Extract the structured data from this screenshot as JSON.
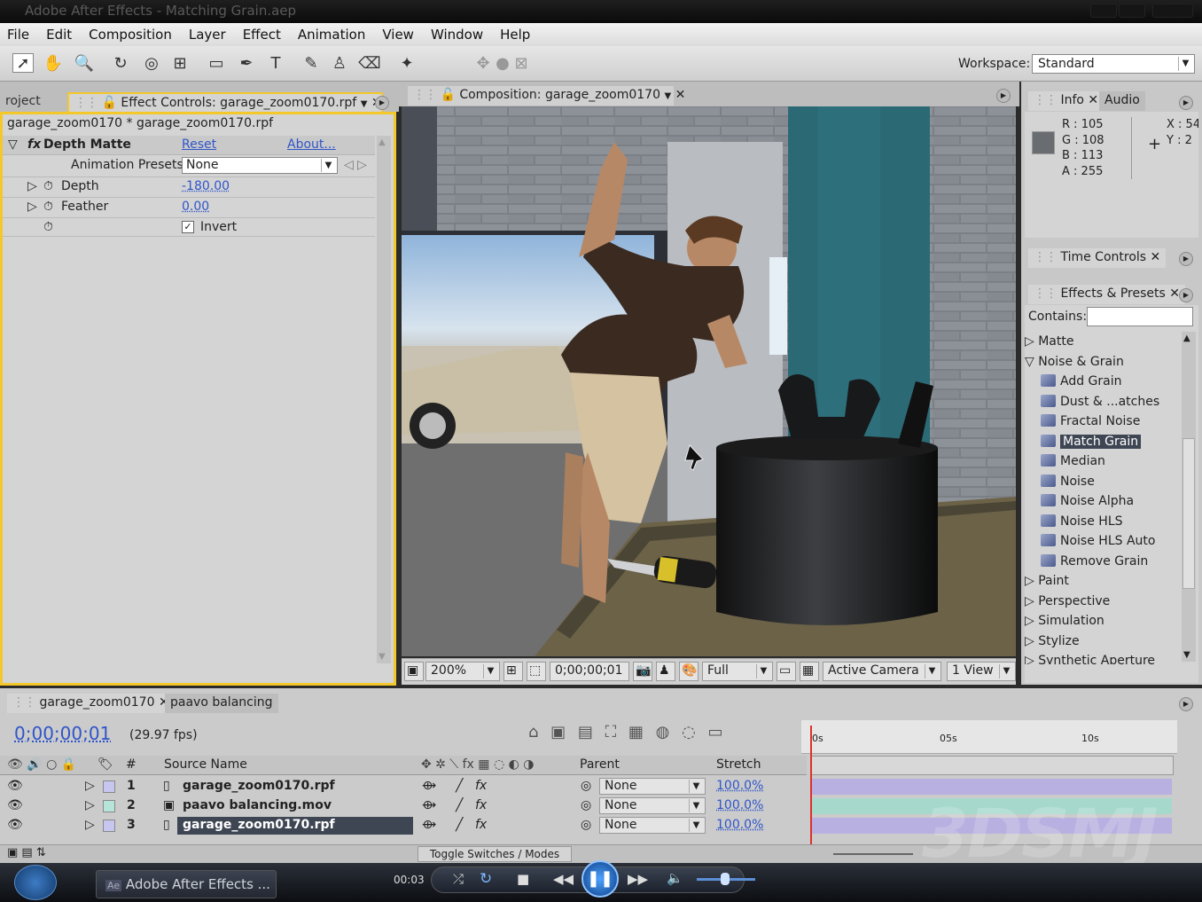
{
  "window": {
    "title": "Adobe After Effects - Matching Grain.aep"
  },
  "menu": [
    "File",
    "Edit",
    "Composition",
    "Layer",
    "Effect",
    "Animation",
    "View",
    "Window",
    "Help"
  ],
  "workspace": {
    "label": "Workspace:",
    "value": "Standard"
  },
  "effect_controls": {
    "project_tab": "roject",
    "tab_label": "Effect Controls: garage_zoom0170.rpf",
    "breadcrumb": "garage_zoom0170 * garage_zoom0170.rpf",
    "effect_name": "Depth Matte",
    "reset": "Reset",
    "about": "About...",
    "presets_label": "Animation Presets:",
    "presets_value": "None",
    "depth_label": "Depth",
    "depth_value": "-180.00",
    "feather_label": "Feather",
    "feather_value": "0.00",
    "invert_label": "Invert"
  },
  "composition": {
    "tab_label": "Composition: garage_zoom0170",
    "zoom": "200%",
    "timecode": "0;00;00;01",
    "resolution": "Full",
    "camera": "Active Camera",
    "views": "1 View"
  },
  "info": {
    "tab": "Info",
    "audio_tab": "Audio",
    "r_label": "R :",
    "r": "105",
    "g_label": "G :",
    "g": "108",
    "b_label": "B :",
    "b": "113",
    "a_label": "A :",
    "a": "255",
    "x_label": "X : 54",
    "y_label": "Y : 2"
  },
  "time_controls": {
    "tab": "Time Controls"
  },
  "effects_presets": {
    "tab": "Effects & Presets",
    "contains_label": "Contains:",
    "categories": [
      {
        "label": "Matte",
        "expanded": false
      },
      {
        "label": "Noise & Grain",
        "expanded": true
      }
    ],
    "noise_items": [
      "Add Grain",
      "Dust & ...atches",
      "Fractal Noise",
      "Match Grain",
      "Median",
      "Noise",
      "Noise Alpha",
      "Noise HLS",
      "Noise HLS Auto",
      "Remove Grain"
    ],
    "selected": "Match Grain",
    "more_categories": [
      "Paint",
      "Perspective",
      "Simulation",
      "Stylize",
      "Synthetic Aperture"
    ]
  },
  "timeline": {
    "tab1": "garage_zoom0170",
    "tab2": "paavo balancing",
    "timecode": "0;00;00;01",
    "fps": "(29.97 fps)",
    "col_num": "#",
    "col_source": "Source Name",
    "col_parent": "Parent",
    "col_stretch": "Stretch",
    "ruler": [
      "0s",
      "05s",
      "10s"
    ],
    "layers": [
      {
        "num": "1",
        "name": "garage_zoom0170.rpf",
        "parent": "None",
        "stretch": "100.0%",
        "color": "#c6c6ee",
        "bar": "#b8b0e0"
      },
      {
        "num": "2",
        "name": "paavo balancing.mov",
        "parent": "None",
        "stretch": "100.0%",
        "color": "#b7e4d8",
        "bar": "#a6d8cc"
      },
      {
        "num": "3",
        "name": "garage_zoom0170.rpf",
        "parent": "None",
        "stretch": "100.0%",
        "color": "#c6c6ee",
        "bar": "#b8b0e0"
      }
    ],
    "toggle": "Toggle Switches / Modes"
  },
  "taskbar": {
    "app": "Adobe After Effects ...",
    "time": "00:03"
  },
  "watermark": "3DSMJ"
}
